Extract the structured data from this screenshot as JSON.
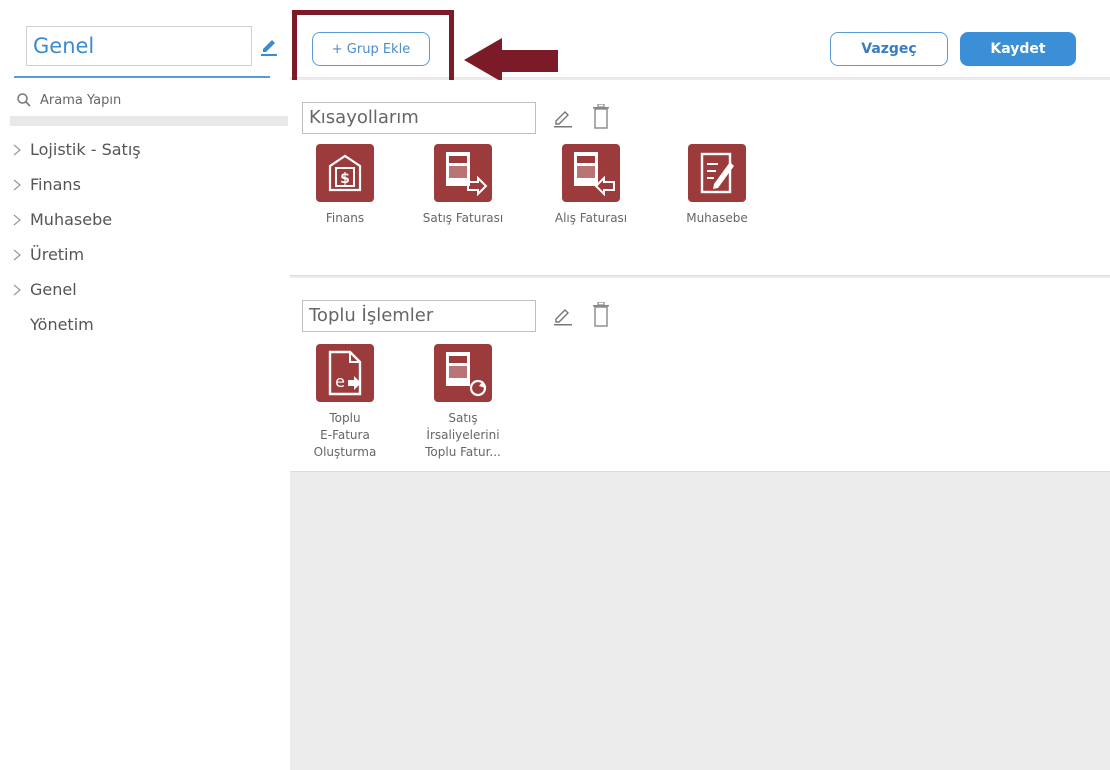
{
  "sidebar": {
    "title": "Genel",
    "search_placeholder": "Arama Yapın",
    "items": [
      {
        "label": "Lojistik - Satış",
        "expandable": true
      },
      {
        "label": "Finans",
        "expandable": true
      },
      {
        "label": "Muhasebe",
        "expandable": true
      },
      {
        "label": "Üretim",
        "expandable": true
      },
      {
        "label": "Genel",
        "expandable": true
      },
      {
        "label": "Yönetim",
        "expandable": false
      }
    ]
  },
  "toolbar": {
    "add_group_label": "+ Grup Ekle",
    "cancel_label": "Vazgeç",
    "save_label": "Kaydet"
  },
  "groups": [
    {
      "name": "Kısayollarım",
      "tiles": [
        {
          "label": "Finans",
          "icon": "finance-dollar-icon"
        },
        {
          "label": "Satış Faturası",
          "icon": "sales-invoice-icon"
        },
        {
          "label": "Alış Faturası",
          "icon": "purchase-invoice-icon"
        },
        {
          "label": "Muhasebe",
          "icon": "accounting-edit-icon"
        }
      ]
    },
    {
      "name": "Toplu İşlemler",
      "tiles": [
        {
          "label": "Toplu E-Fatura Oluşturma",
          "lines": [
            "Toplu",
            "E-Fatura",
            "Oluşturma"
          ],
          "icon": "e-invoice-icon"
        },
        {
          "label": "Satış İrsaliyelerini Toplu Fatur...",
          "lines": [
            "Satış",
            "İrsaliyelerini",
            "Toplu Fatur..."
          ],
          "icon": "dispatch-refresh-icon"
        }
      ]
    }
  ],
  "colors": {
    "accent": "#3a8fd6",
    "tile": "#9b3b3b",
    "highlight": "#7b1b28"
  }
}
